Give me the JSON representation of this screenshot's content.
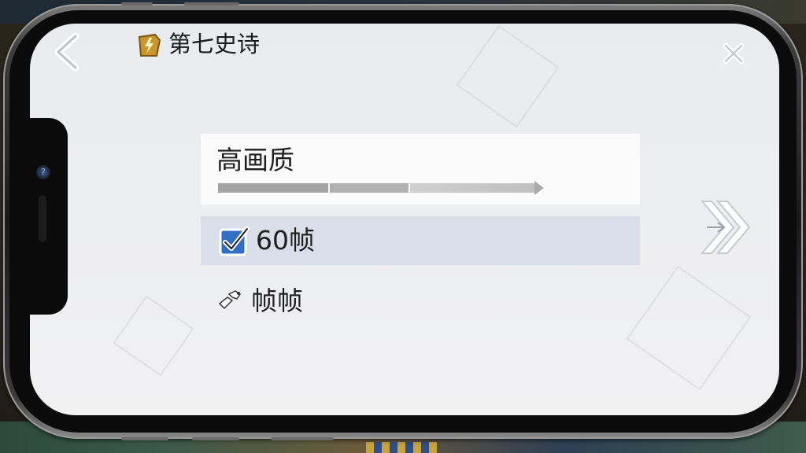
{
  "header": {
    "title": "第七史诗",
    "title_icon": "lightning-app-icon",
    "back_icon": "chevron-left-icon",
    "close_icon": "close-x-icon"
  },
  "quality": {
    "label": "高画质"
  },
  "fps_option": {
    "label": "60帧",
    "checked": true
  },
  "frames_option": {
    "label": "帧帧",
    "icon": "wrench-settings-icon"
  },
  "next_icon": "double-arrow-right-icon",
  "colors": {
    "checkbox_fill": "#2f6fc4",
    "row_highlight": "#d9dfe8",
    "title_icon_gold": "#c9962b"
  }
}
